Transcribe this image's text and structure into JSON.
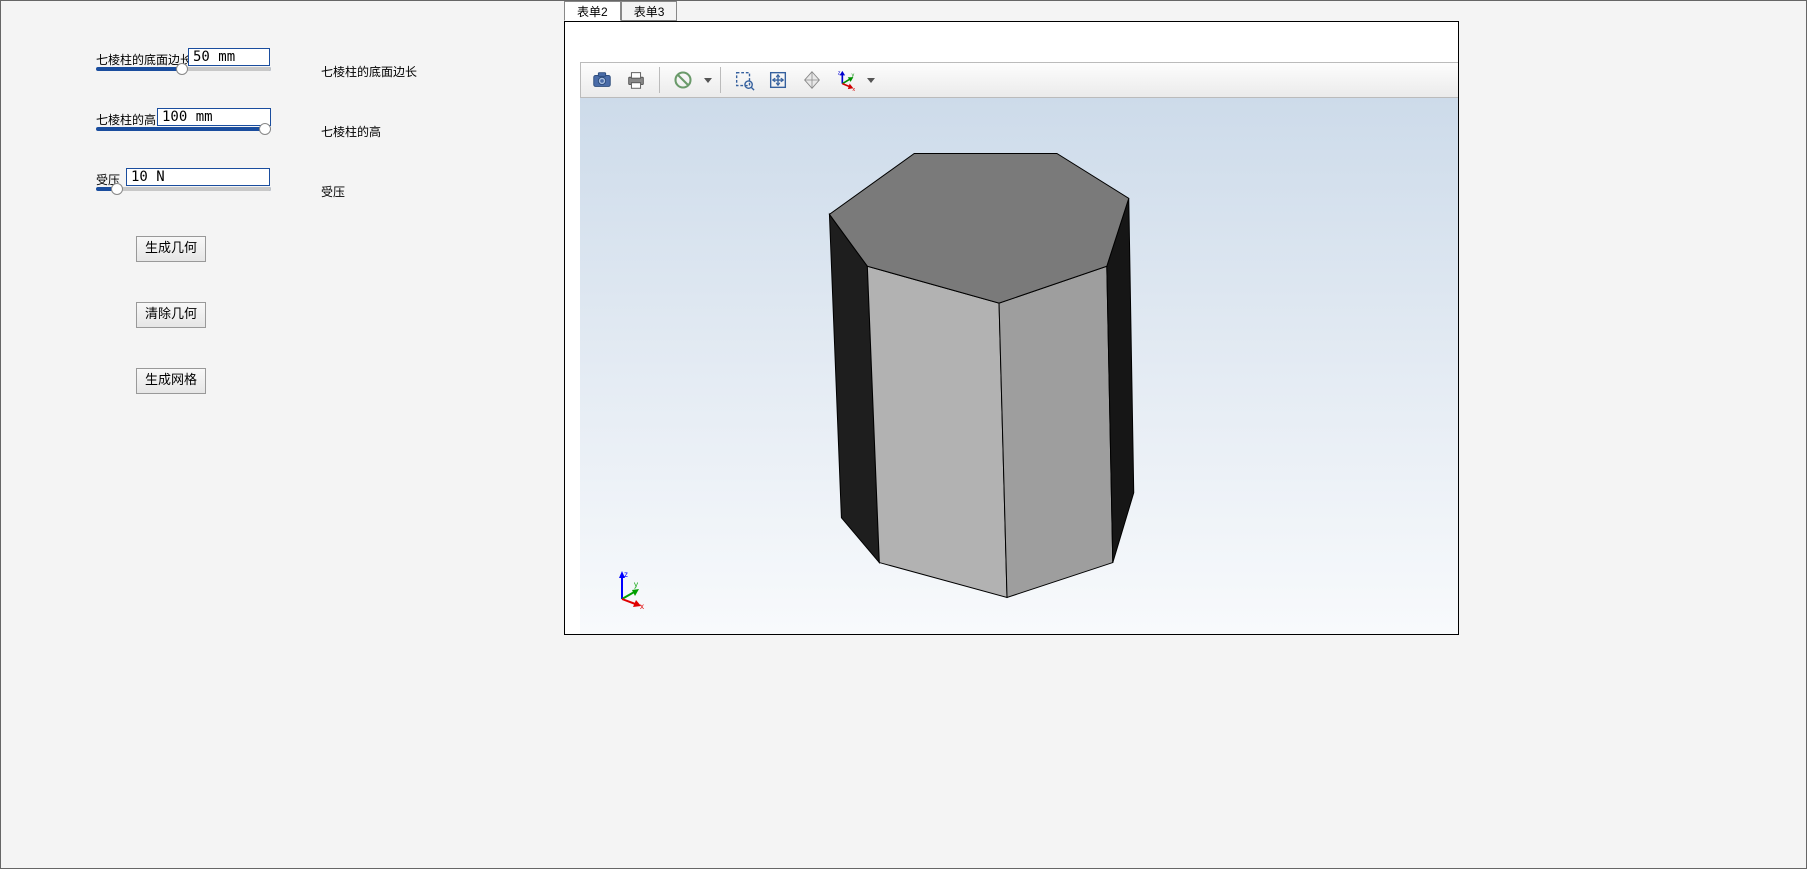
{
  "tabs": {
    "tab2": "表单2",
    "tab3": "表单3",
    "active": "表单2"
  },
  "params": {
    "base_edge": {
      "label": "七棱柱的底面边长",
      "value": "50 mm",
      "side_label": "七棱柱的底面边长"
    },
    "height": {
      "label": "七棱柱的高",
      "value": "100 mm",
      "side_label": "七棱柱的高"
    },
    "pressure": {
      "label": "受压",
      "value": "10 N",
      "side_label": "受压"
    }
  },
  "buttons": {
    "gen_geometry": "生成几何",
    "clear_geometry": "清除几何",
    "gen_mesh": "生成网格"
  },
  "toolbar": {
    "camera": "camera-icon",
    "print": "print-icon",
    "deny": "deny-icon",
    "zoombox": "zoom-box-icon",
    "fit": "fit-icon",
    "diamond": "reset-view-icon",
    "axes": "axes-icon"
  },
  "chart_data": {
    "type": "3d-prism",
    "description": "Heptagonal prism (7-sided)",
    "base_edge_mm": 50,
    "height_mm": 100,
    "pressure_N": 10
  }
}
